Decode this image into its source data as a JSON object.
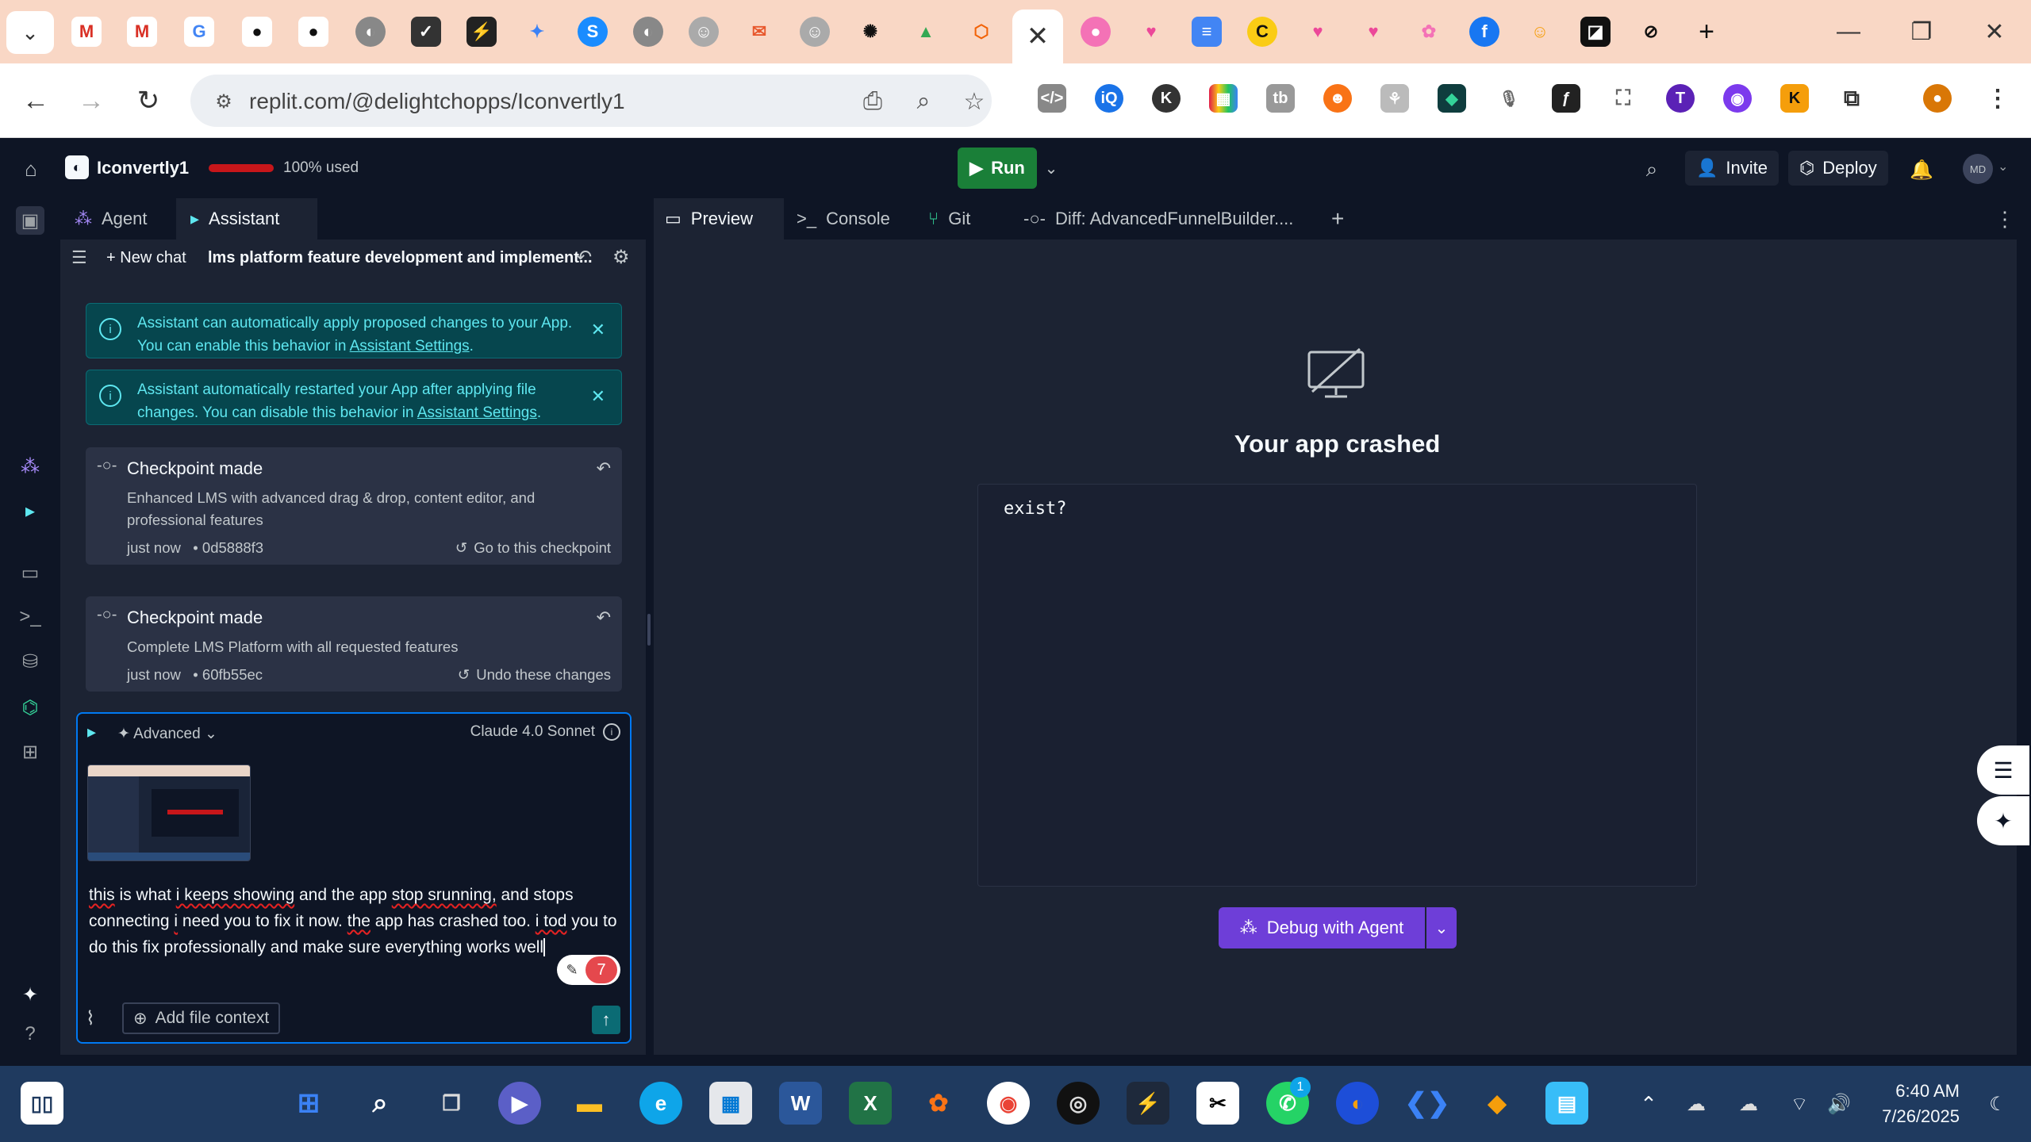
{
  "browser": {
    "active_tab_close": "✕",
    "new_tab": "+",
    "url": "replit.com/@delightchopps/Iconvertly1"
  },
  "replit": {
    "project_name": "Iconvertly1",
    "usage": "100% used",
    "run_label": "Run",
    "invite_label": "Invite",
    "deploy_label": "Deploy",
    "avatar_initials": "MD"
  },
  "assistant": {
    "tabs": [
      {
        "label": "Agent"
      },
      {
        "label": "Assistant"
      }
    ],
    "new_chat": "New chat",
    "chat_title": "lms platform feature development and implement...",
    "notice1": {
      "text": "Assistant can automatically apply proposed changes to your App. You can enable this behavior in ",
      "link": "Assistant Settings",
      "end": "."
    },
    "notice2": {
      "text": "Assistant automatically restarted your App after applying file changes. You can disable this behavior in ",
      "link": "Assistant Settings",
      "end": "."
    },
    "checkpoint1": {
      "title": "Checkpoint made",
      "desc": "Enhanced LMS with advanced drag & drop, content editor, and professional features",
      "time": "just now",
      "hash": "• 0d5888f3",
      "action": "Go to this checkpoint"
    },
    "checkpoint2": {
      "title": "Checkpoint made",
      "desc": "Complete LMS Platform with all requested features",
      "time": "just now",
      "hash": "• 60fb55ec",
      "action": "Undo these changes"
    },
    "composer": {
      "mode": "Advanced",
      "model": "Claude 4.0 Sonnet",
      "message_parts": [
        "this",
        " is what ",
        "i keeps showing",
        " and the app ",
        "stop srunning,",
        " and stops connecting ",
        "i",
        " need you to fix it now. ",
        "the",
        " app has crashed too. ",
        "i tod",
        " you to do this fix professionally and make sure everything works well"
      ],
      "badge_count": "7",
      "add_context": "Add file context"
    }
  },
  "workspace": {
    "tabs": [
      {
        "label": "Preview"
      },
      {
        "label": "Console"
      },
      {
        "label": "Git"
      },
      {
        "label": "Diff: AdvancedFunnelBuilder...."
      }
    ],
    "add_tab": "+",
    "crash_title": "Your app crashed",
    "crash_log": "exist?",
    "debug_label": "Debug with Agent"
  },
  "taskbar": {
    "whatsapp_badge": "1",
    "time": "6:40 AM",
    "date": "7/26/2025"
  },
  "colors": {
    "accent": "#0079f2",
    "run_green": "#1a7f38",
    "debug_purple": "#6e3ed8",
    "notice_teal": "#06464e"
  }
}
